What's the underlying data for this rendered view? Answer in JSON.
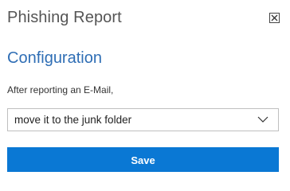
{
  "header": {
    "title": "Phishing Report"
  },
  "section": {
    "title": "Configuration"
  },
  "form": {
    "label": "After reporting an E-Mail,",
    "select_value": "move it to the junk folder",
    "save_label": "Save"
  },
  "icons": {
    "close": "close-icon",
    "dropdown": "chevron-down-icon"
  },
  "colors": {
    "accent": "#2f6eb5",
    "button": "#0a78d4"
  }
}
